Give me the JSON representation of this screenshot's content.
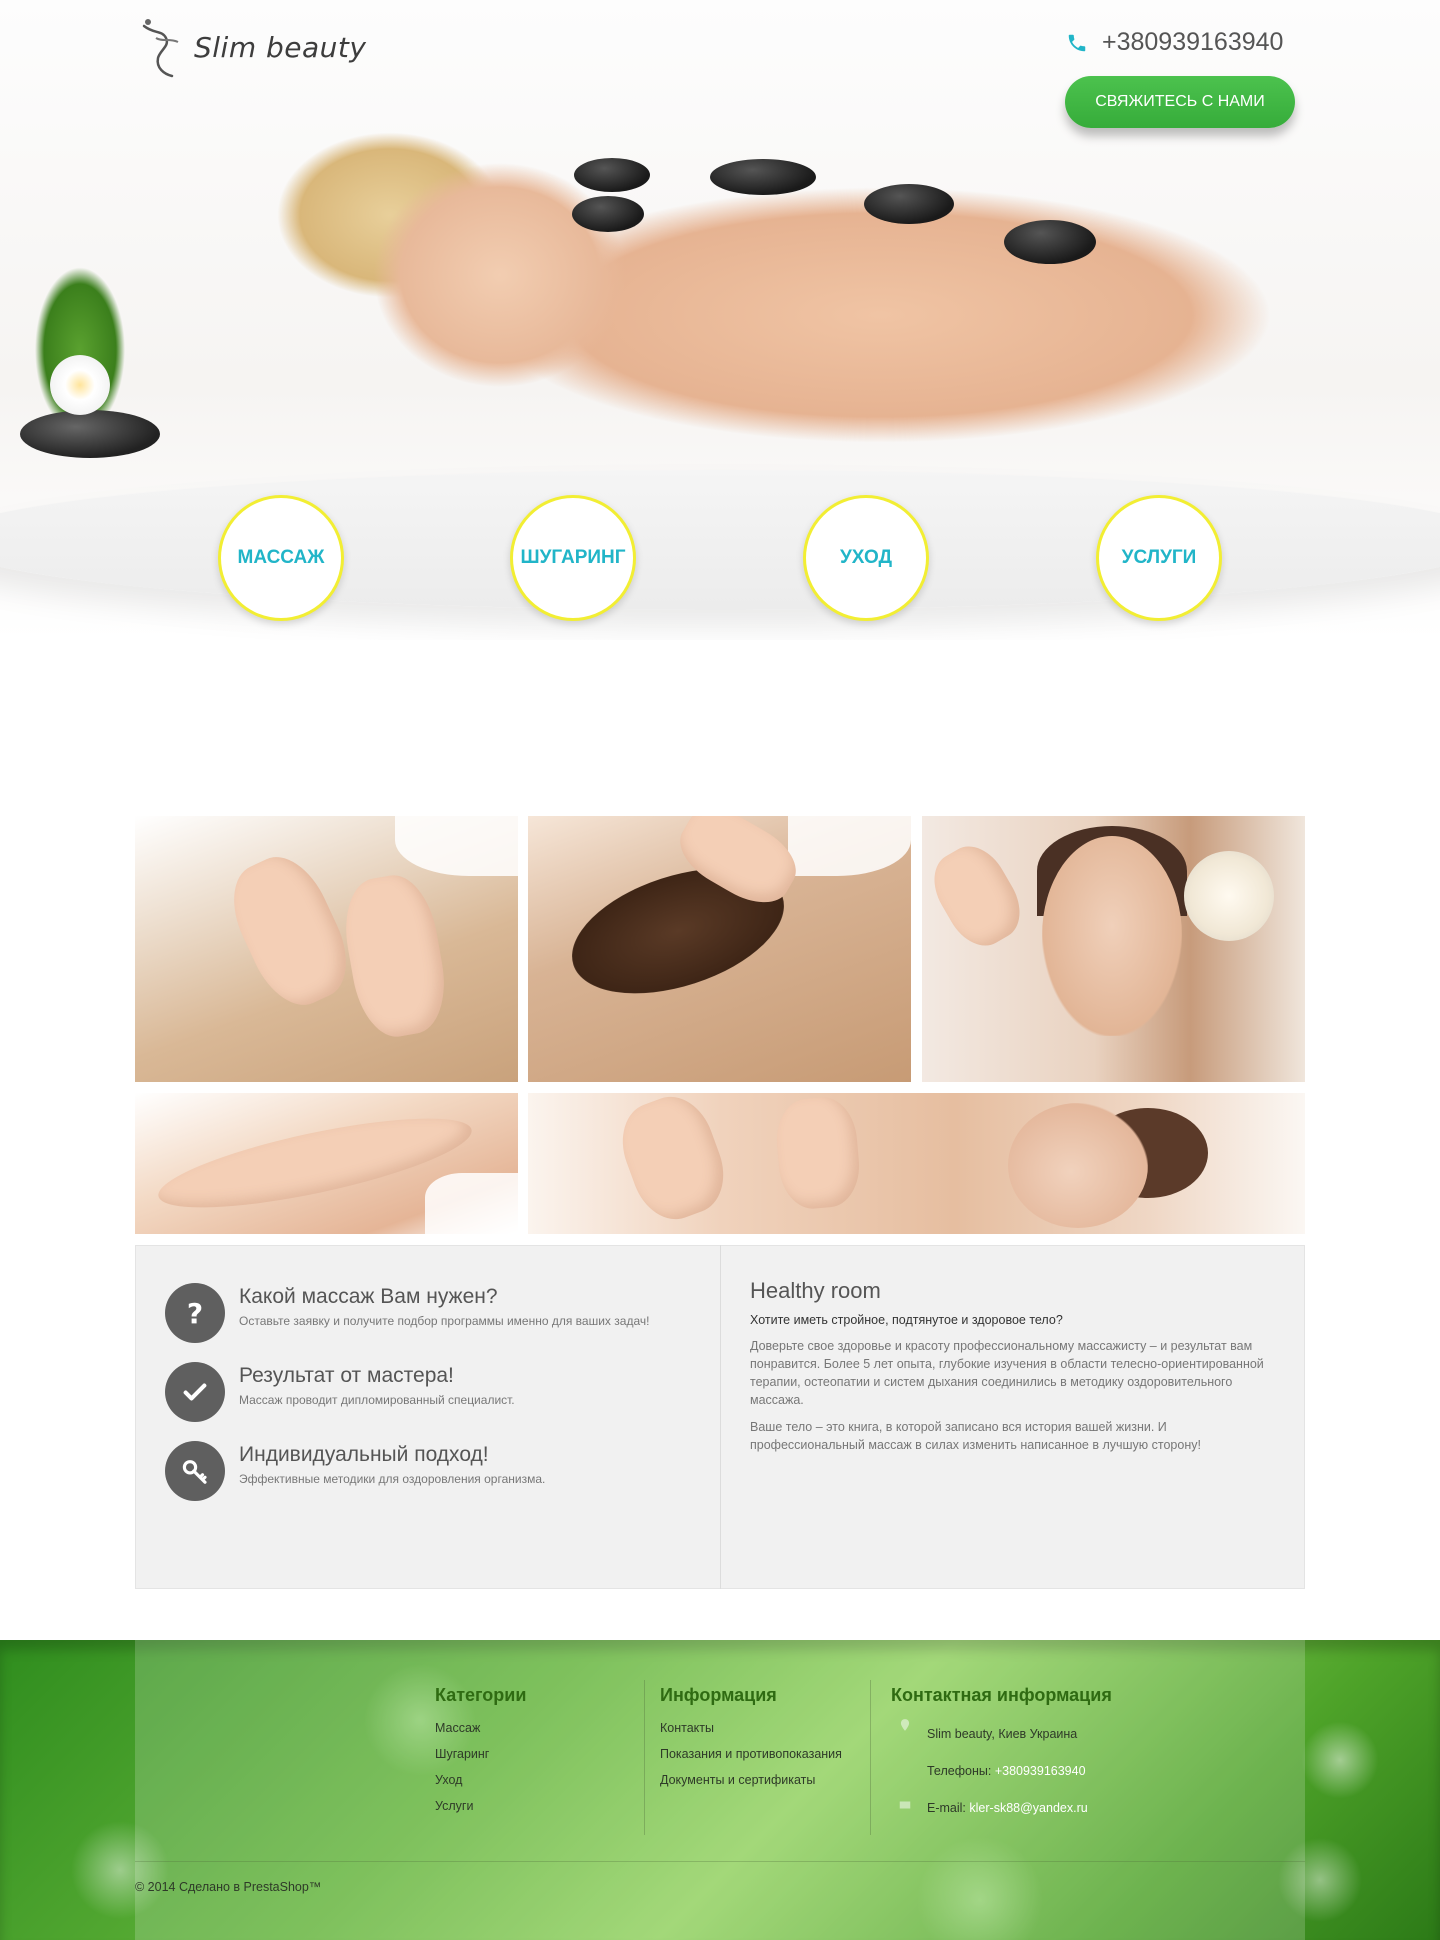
{
  "header": {
    "logo_text": "Slim beauty",
    "phone": "+380939163940",
    "cta_label": "СВЯЖИТЕСЬ С НАМИ"
  },
  "categories": [
    {
      "label": "МАССАЖ"
    },
    {
      "label": "ШУГАРИНГ"
    },
    {
      "label": "УХОД"
    },
    {
      "label": "УСЛУГИ"
    }
  ],
  "features": [
    {
      "title": "Какой массаж Вам нужен?",
      "desc": "Оставьте заявку и получите подбор программы именно для ваших задач!",
      "icon": "question-icon"
    },
    {
      "title": "Результат от мастера!",
      "desc": "Массаж проводит дипломированный специалист.",
      "icon": "check-icon"
    },
    {
      "title": "Индивидуальный подход!",
      "desc": "Эффективные методики для оздоровления организма.",
      "icon": "key-icon"
    }
  ],
  "healthy_room": {
    "title": "Healthy room",
    "subtitle": "Хотите иметь стройное, подтянутое и здоровое тело?",
    "p1": "Доверьте свое здоровье и красоту профессиональному массажисту – и результат вам понравится. Более 5 лет опыта, глубокие изучения в области телесно-ориентированной терапии, остеопатии и систем дыхания соединились в методику оздоровительного массажа.",
    "p2": "Ваше тело – это книга, в которой записано вся история вашей жизни. И профессиональный массаж в силах изменить написанное в лучшую сторону!"
  },
  "footer": {
    "categories_title": "Категории",
    "categories": [
      "Массаж",
      "Шугаринг",
      "Уход",
      "Услуги"
    ],
    "info_title": "Информация",
    "info_links": [
      "Контакты",
      "Показания и противопоказания",
      "Документы и сертификаты"
    ],
    "contact_title": "Контактная информация",
    "address": "Slim beauty, Киев Украина",
    "phone_label": "Телефоны:",
    "phone": "+380939163940",
    "email_label": "E-mail:",
    "email": "kler-sk88@yandex.ru",
    "copyright": "© 2014 Сделано в PrestaShop™"
  },
  "colors": {
    "accent_green": "#3cb43f",
    "circle_text": "#21b5c8",
    "circle_border": "#f2ee33"
  }
}
